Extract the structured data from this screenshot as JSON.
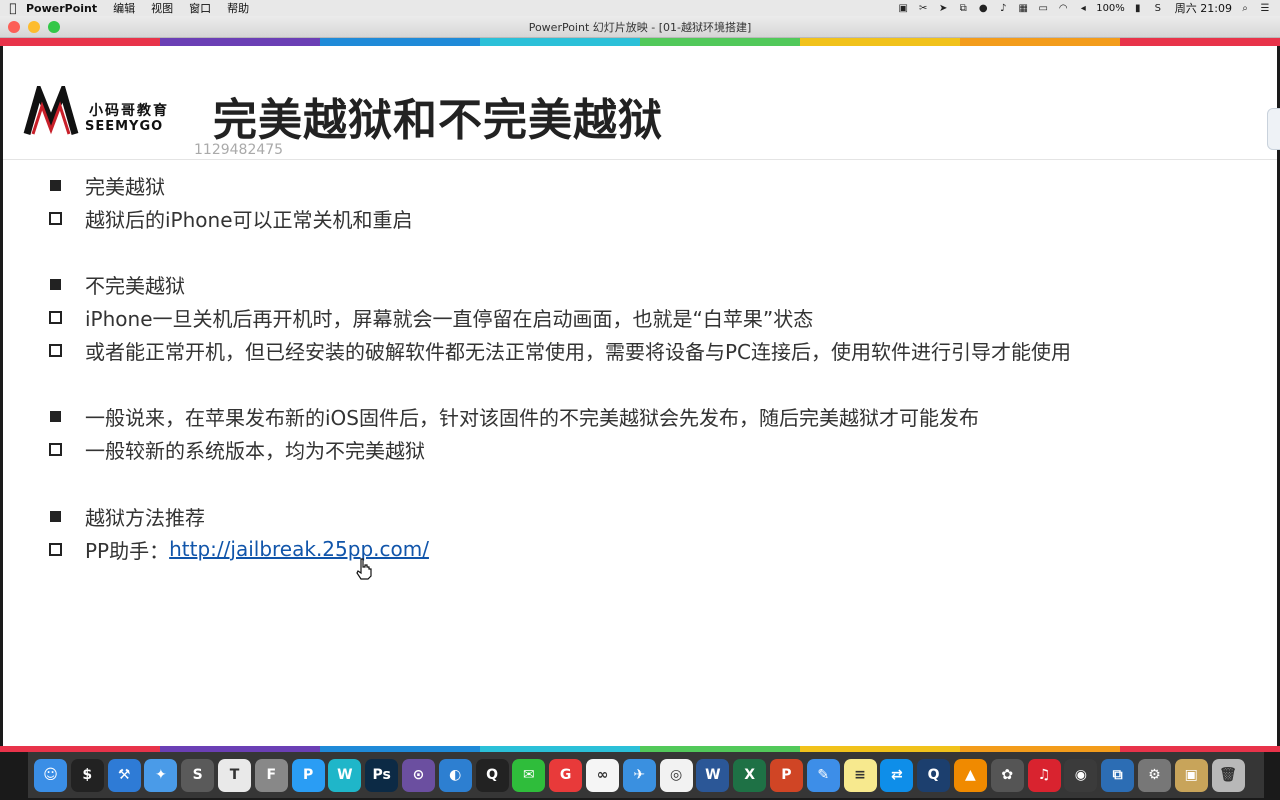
{
  "menubar": {
    "app_name": "PowerPoint",
    "menus": [
      "编辑",
      "视图",
      "窗口",
      "帮助"
    ],
    "battery": "100%",
    "clock": "周六 21:09"
  },
  "window": {
    "title": "PowerPoint 幻灯片放映 - [01-越狱环境搭建]"
  },
  "rainbow_colors": [
    "#e8334a",
    "#6b3fb5",
    "#1f8ad8",
    "#2bc0d8",
    "#52c95a",
    "#f1c21b",
    "#f39c1b",
    "#e8334a"
  ],
  "slide": {
    "logo_cn": "小码哥教育",
    "logo_en": "SEEMYGO",
    "title": "完美越狱和不完美越狱",
    "watermark": "1129482475",
    "bullets": [
      {
        "type": "filled",
        "text": "完美越狱"
      },
      {
        "type": "hollow",
        "text": "越狱后的iPhone可以正常关机和重启"
      },
      {
        "type": "filled",
        "text": "不完美越狱"
      },
      {
        "type": "hollow",
        "text": "iPhone一旦关机后再开机时，屏幕就会一直停留在启动画面，也就是“白苹果”状态"
      },
      {
        "type": "hollow",
        "text": "或者能正常开机，但已经安装的破解软件都无法正常使用，需要将设备与PC连接后，使用软件进行引导才能使用"
      },
      {
        "type": "filled",
        "text": "一般说来，在苹果发布新的iOS固件后，针对该固件的不完美越狱会先发布，随后完美越狱才可能发布"
      },
      {
        "type": "hollow",
        "text": "一般较新的系统版本，均为不完美越狱"
      },
      {
        "type": "filled",
        "text": "越狱方法推荐"
      },
      {
        "type": "hollow",
        "text": "PP助手：",
        "link": "http://jailbreak.25pp.com/"
      }
    ]
  },
  "dock": [
    {
      "name": "finder-icon",
      "color": "#3a8ee6",
      "glyph": "☺"
    },
    {
      "name": "terminal-icon",
      "color": "#222222",
      "glyph": "$"
    },
    {
      "name": "xcode-icon",
      "color": "#2e7bd6",
      "glyph": "⚒"
    },
    {
      "name": "xcode-simulator-icon",
      "color": "#4a9be8",
      "glyph": "✦"
    },
    {
      "name": "sublime-text-icon",
      "color": "#5a5a5a",
      "glyph": "S"
    },
    {
      "name": "typora-icon",
      "color": "#e9e9e9",
      "glyph": "T"
    },
    {
      "name": "fun-app-icon",
      "color": "#888888",
      "glyph": "F"
    },
    {
      "name": "p-app-icon",
      "color": "#2a9df4",
      "glyph": "P"
    },
    {
      "name": "webstorm-icon",
      "color": "#1fb6c9",
      "glyph": "W"
    },
    {
      "name": "photoshop-icon",
      "color": "#0c2a45",
      "glyph": "Ps"
    },
    {
      "name": "github-icon",
      "color": "#6b4fa0",
      "glyph": "⊙"
    },
    {
      "name": "browser-icon",
      "color": "#2d7fd1",
      "glyph": "◐"
    },
    {
      "name": "qq-icon",
      "color": "#222222",
      "glyph": "Q"
    },
    {
      "name": "wechat-icon",
      "color": "#2fbd3b",
      "glyph": "✉"
    },
    {
      "name": "g-app-icon",
      "color": "#e83a3a",
      "glyph": "G"
    },
    {
      "name": "baidu-netdisk-icon",
      "color": "#f5f5f5",
      "glyph": "∞"
    },
    {
      "name": "bird-app-icon",
      "color": "#3a90e0",
      "glyph": "✈"
    },
    {
      "name": "chrome-icon",
      "color": "#f2f2f2",
      "glyph": "◎"
    },
    {
      "name": "word-icon",
      "color": "#2b5797",
      "glyph": "W"
    },
    {
      "name": "excel-icon",
      "color": "#1e7145",
      "glyph": "X"
    },
    {
      "name": "powerpoint-icon",
      "color": "#d04525",
      "glyph": "P"
    },
    {
      "name": "pen-app-icon",
      "color": "#3d8ee8",
      "glyph": "✎"
    },
    {
      "name": "notes-icon",
      "color": "#f7e98e",
      "glyph": "≡"
    },
    {
      "name": "teamviewer-icon",
      "color": "#0e8ee9",
      "glyph": "⇄"
    },
    {
      "name": "quicktime-icon",
      "color": "#1c3f6e",
      "glyph": "Q"
    },
    {
      "name": "vlc-icon",
      "color": "#f08a00",
      "glyph": "▲"
    },
    {
      "name": "photo-slideshow-icon",
      "color": "#555555",
      "glyph": "✿"
    },
    {
      "name": "netease-music-icon",
      "color": "#d9232f",
      "glyph": "♫"
    },
    {
      "name": "speaker-app-icon",
      "color": "#3b3b3b",
      "glyph": "◉"
    },
    {
      "name": "vmware-icon",
      "color": "#2c6db4",
      "glyph": "⧉"
    },
    {
      "name": "system-preferences-icon",
      "color": "#777777",
      "glyph": "⚙"
    },
    {
      "name": "archive-icon",
      "color": "#c8a45a",
      "glyph": "▣"
    },
    {
      "name": "trash-icon",
      "color": "#b8b8b8",
      "glyph": "🗑"
    }
  ]
}
